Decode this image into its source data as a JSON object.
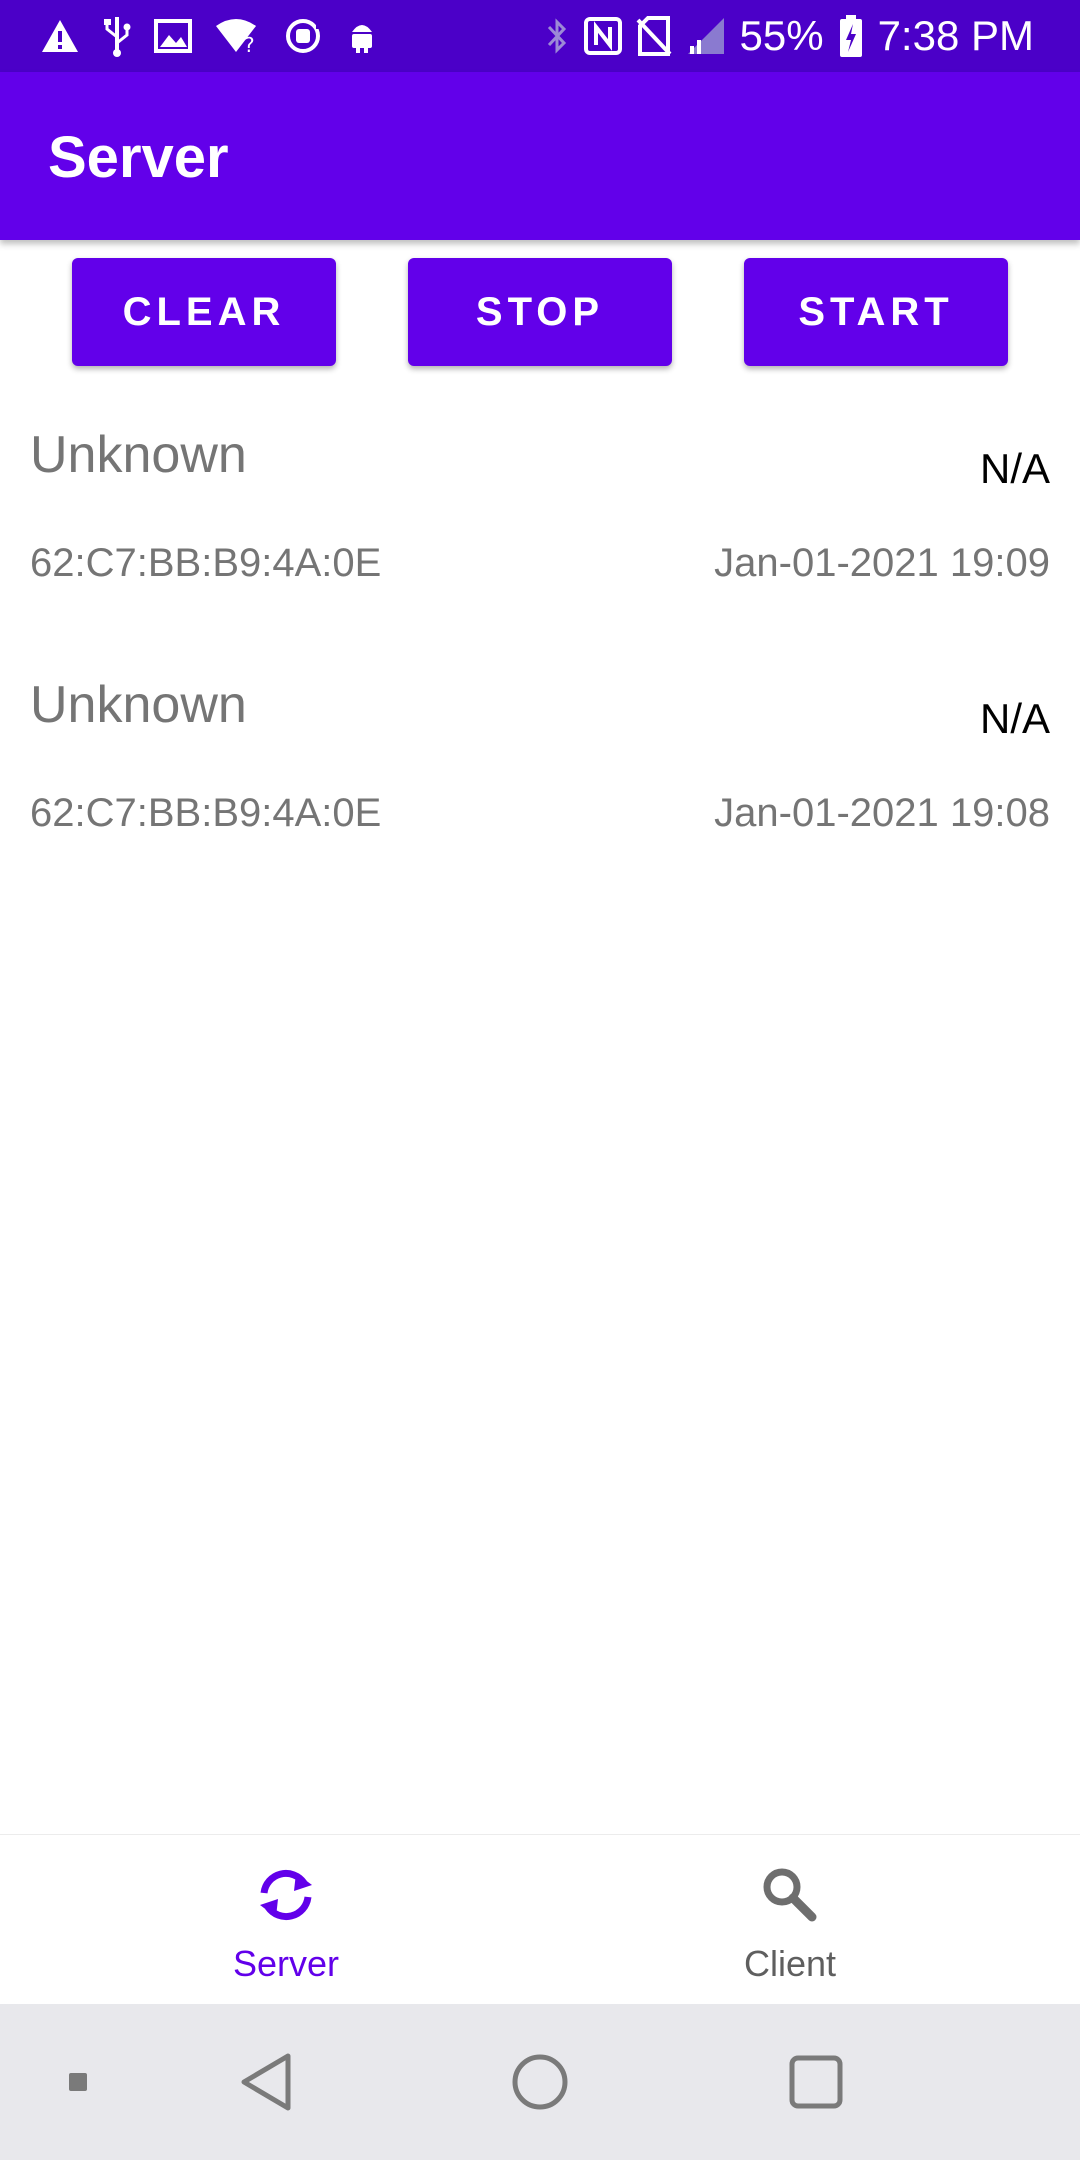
{
  "status_bar": {
    "battery": "55%",
    "time": "7:38 PM",
    "icons": [
      "warning-icon",
      "usb-icon",
      "image-icon",
      "wifi-question-icon",
      "sync-icon",
      "android-icon",
      "bug-icon",
      "bluetooth-icon",
      "nfc-icon",
      "no-sim-icon",
      "signal-icon",
      "battery-icon"
    ]
  },
  "app_bar": {
    "title": "Server"
  },
  "actions": {
    "clear_label": "CLEAR",
    "stop_label": "STOP",
    "start_label": "START"
  },
  "entries": [
    {
      "name": "Unknown",
      "rssi": "N/A",
      "mac": "62:C7:BB:B9:4A:0E",
      "time": "Jan-01-2021 19:09"
    },
    {
      "name": "Unknown",
      "rssi": "N/A",
      "mac": "62:C7:BB:B9:4A:0E",
      "time": "Jan-01-2021 19:08"
    }
  ],
  "bottom_nav": {
    "items": [
      {
        "label": "Server",
        "icon": "sync-icon",
        "active": true
      },
      {
        "label": "Client",
        "icon": "search-icon",
        "active": false
      }
    ]
  },
  "colors": {
    "primary": "#6200ea",
    "status_bar": "#4b00c8",
    "secondary_text": "#757575",
    "nav_bar": "#e8e8ec"
  }
}
